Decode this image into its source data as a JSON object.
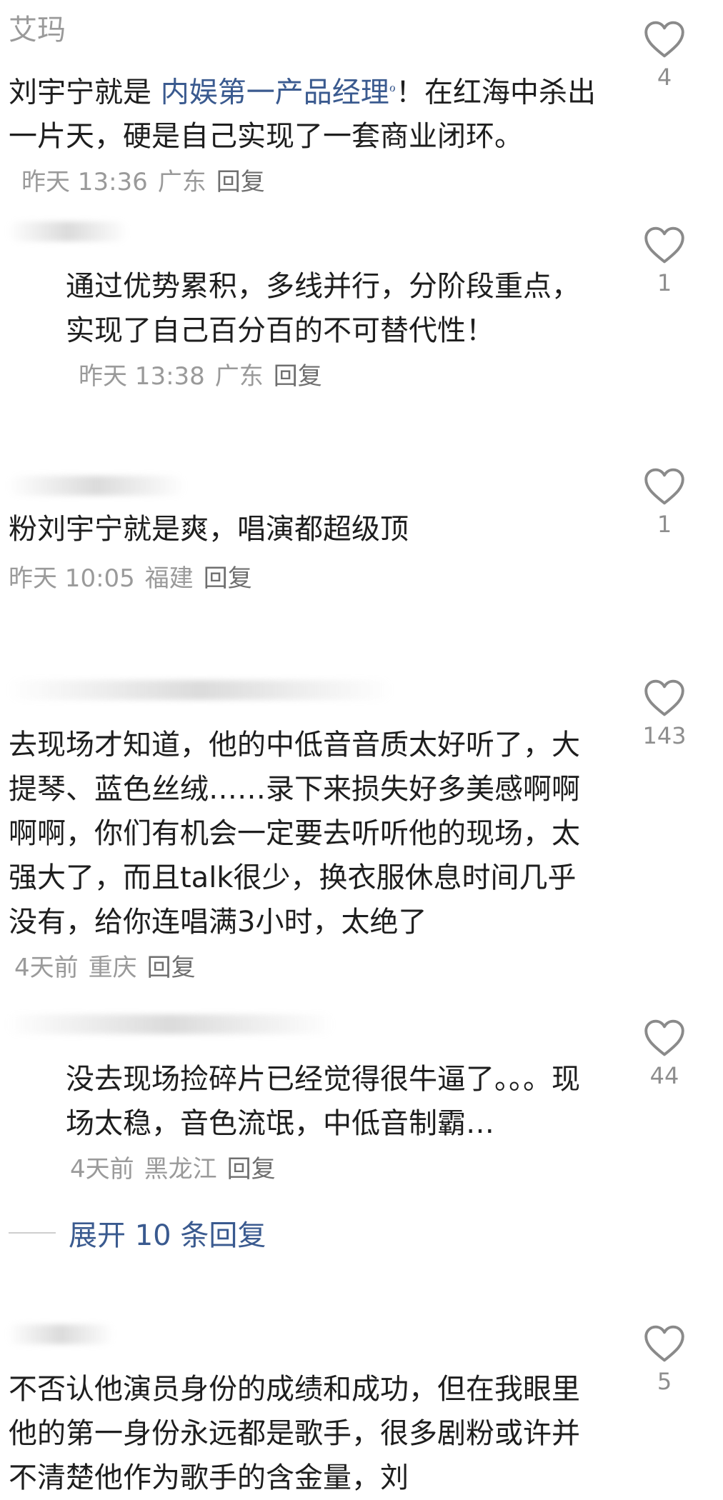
{
  "comments": [
    {
      "username": "艾玛",
      "text_before": "刘宇宁就是 ",
      "link": "内娱第一产品经理",
      "text_after": "！在红海中杀出一片天，硬是自己实现了一套商业闭环。",
      "time": "昨天 13:36",
      "location": "广东",
      "reply": "回复",
      "likes": "4"
    },
    {
      "text": "通过优势累积，多线并行，分阶段重点，实现了自己百分百的不可替代性！",
      "time": "昨天 13:38",
      "location": "广东",
      "reply": "回复",
      "likes": "1"
    },
    {
      "text": "粉刘宇宁就是爽，唱演都超级顶",
      "time": "昨天 10:05",
      "location": "福建",
      "reply": "回复",
      "likes": "1"
    },
    {
      "text": "去现场才知道，他的中低音音质太好听了，大提琴、蓝色丝绒……录下来损失好多美感啊啊啊啊，你们有机会一定要去听听他的现场，太强大了，而且talk很少，换衣服休息时间几乎没有，给你连唱满3小时，太绝了",
      "time": "4天前",
      "location": "重庆",
      "reply": "回复",
      "likes": "143"
    },
    {
      "text": "没去现场捡碎片已经觉得很牛逼了。。。现场太稳，音色流氓，中低音制霸…",
      "time": "4天前",
      "location": "黑龙江",
      "reply": "回复",
      "likes": "44"
    },
    {
      "text": "不否认他演员身份的成绩和成功，但在我眼里他的第一身份永远都是歌手，很多剧粉或许并不清楚他作为歌手的含金量，刘",
      "likes": "5"
    }
  ],
  "expand_replies": "展开 10 条回复",
  "icons": {
    "like": "heart-outline-icon"
  },
  "colors": {
    "text": "#1e1e1e",
    "meta": "#9a9a9a",
    "link": "#3a5a8f"
  }
}
